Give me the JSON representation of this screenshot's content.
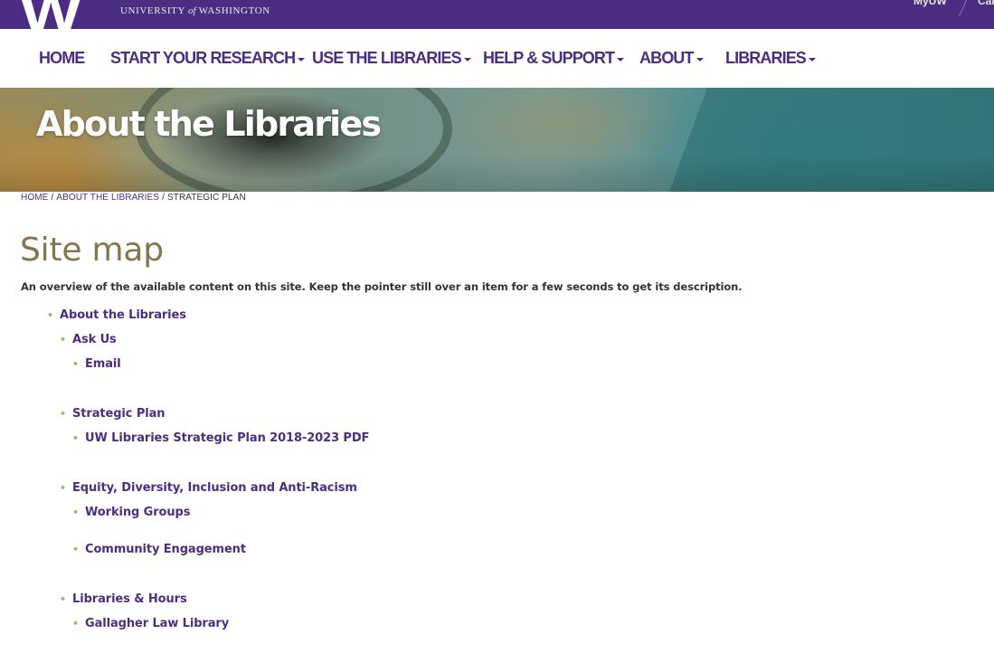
{
  "header": {
    "logo": "W",
    "wordmark_left": "UNIVERSITY",
    "wordmark_of": "of",
    "wordmark_right": "WASHINGTON",
    "top_links": [
      "MyUW",
      "Cal"
    ]
  },
  "nav": {
    "items": [
      {
        "label": "HOME",
        "dropdown": false
      },
      {
        "label": "START YOUR RESEARCH",
        "dropdown": true
      },
      {
        "label": "USE THE LIBRARIES",
        "dropdown": true
      },
      {
        "label": "HELP & SUPPORT",
        "dropdown": true
      },
      {
        "label": "ABOUT",
        "dropdown": true
      },
      {
        "label": "LIBRARIES",
        "dropdown": true
      }
    ]
  },
  "hero": {
    "title": "About the Libraries"
  },
  "breadcrumb": {
    "items": [
      "HOME",
      "ABOUT THE LIBRARIES",
      "STRATEGIC PLAN"
    ],
    "separator": "/"
  },
  "page": {
    "title": "Site map",
    "intro": "An overview of the available content on this site. Keep the pointer still over an item for a few seconds to get its description."
  },
  "sitemap": [
    {
      "label": "About the Libraries",
      "level": 1
    },
    {
      "label": "Ask Us",
      "level": 2
    },
    {
      "label": "Email",
      "level": 3
    },
    {
      "label": "Strategic Plan",
      "level": 2
    },
    {
      "label": "UW Libraries Strategic Plan 2018-2023 PDF",
      "level": 3
    },
    {
      "label": "Equity, Diversity, Inclusion and Anti-Racism",
      "level": 2
    },
    {
      "label": "Working Groups",
      "level": 3
    },
    {
      "label": "Community Engagement",
      "level": 3
    },
    {
      "label": "Libraries & Hours",
      "level": 2
    },
    {
      "label": "Gallagher Law Library",
      "level": 3
    }
  ],
  "colors": {
    "uw_purple": "#4b2e83",
    "uw_gold": "#85754d",
    "bullet_gold": "#b7a57a"
  }
}
